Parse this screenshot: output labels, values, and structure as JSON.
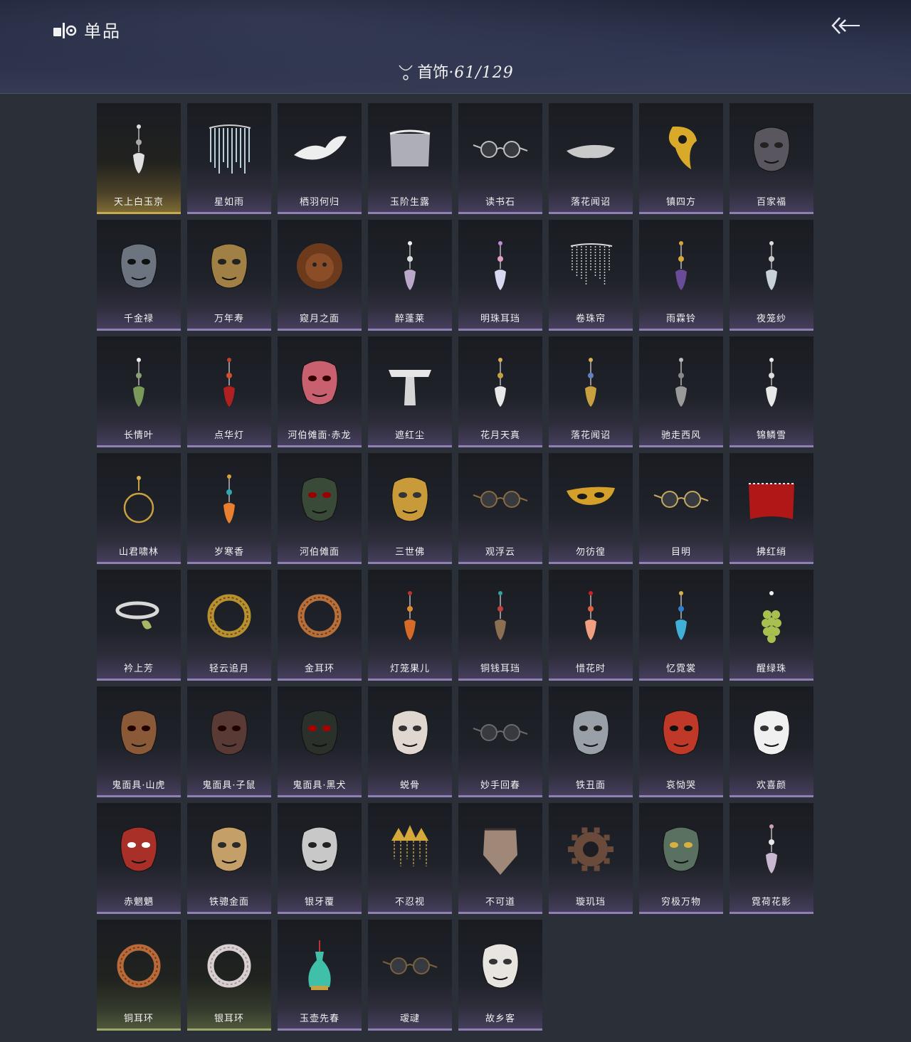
{
  "header": {
    "title": "单品",
    "category_label": "首饰",
    "category_count": "·61/129"
  },
  "items": [
    {
      "name": "天上白玉京",
      "rarity": "gold",
      "icon": "pendant-drop"
    },
    {
      "name": "星如雨",
      "rarity": "purple",
      "icon": "chain-curtain"
    },
    {
      "name": "栖羽何归",
      "rarity": "purple",
      "icon": "wing"
    },
    {
      "name": "玉阶生露",
      "rarity": "purple",
      "icon": "veil"
    },
    {
      "name": "读书石",
      "rarity": "purple",
      "icon": "glasses-round"
    },
    {
      "name": "落花闻诏",
      "rarity": "purple",
      "icon": "headband"
    },
    {
      "name": "镇四方",
      "rarity": "purple",
      "icon": "gold-filigree"
    },
    {
      "name": "百家福",
      "rarity": "purple",
      "icon": "mask-ram"
    },
    {
      "name": "千金禄",
      "rarity": "purple",
      "icon": "mask-mouse-silver"
    },
    {
      "name": "万年寿",
      "rarity": "purple",
      "icon": "mask-mouse-gold"
    },
    {
      "name": "窥月之面",
      "rarity": "purple",
      "icon": "mask-lion"
    },
    {
      "name": "醉蓬莱",
      "rarity": "purple",
      "icon": "flower-hairpin"
    },
    {
      "name": "明珠耳珰",
      "rarity": "purple",
      "icon": "pearl-earring"
    },
    {
      "name": "卷珠帘",
      "rarity": "purple",
      "icon": "bead-curtain"
    },
    {
      "name": "雨霖铃",
      "rarity": "purple",
      "icon": "bell-earring"
    },
    {
      "name": "夜笼纱",
      "rarity": "purple",
      "icon": "silver-tassel"
    },
    {
      "name": "长情叶",
      "rarity": "purple",
      "icon": "leaf-earring"
    },
    {
      "name": "点华灯",
      "rarity": "purple",
      "icon": "lantern"
    },
    {
      "name": "河伯傩面·赤龙",
      "rarity": "purple",
      "icon": "mask-red-dragon"
    },
    {
      "name": "遮红尘",
      "rarity": "purple",
      "icon": "white-ribbon"
    },
    {
      "name": "花月天真",
      "rarity": "purple",
      "icon": "gold-stick-earring"
    },
    {
      "name": "落花闻诏",
      "rarity": "purple",
      "icon": "gold-stick-earring-2"
    },
    {
      "name": "驰走西风",
      "rarity": "purple",
      "icon": "feather-earring"
    },
    {
      "name": "锦鳞雪",
      "rarity": "purple",
      "icon": "fish-earring"
    },
    {
      "name": "山君啸林",
      "rarity": "purple",
      "icon": "hoop-earring"
    },
    {
      "name": "岁寒香",
      "rarity": "purple",
      "icon": "gem-earring"
    },
    {
      "name": "河伯傩面",
      "rarity": "purple",
      "icon": "mask-green-dragon"
    },
    {
      "name": "三世佛",
      "rarity": "purple",
      "icon": "mask-three-faces"
    },
    {
      "name": "观浮云",
      "rarity": "purple",
      "icon": "goggles"
    },
    {
      "name": "勿彷徨",
      "rarity": "purple",
      "icon": "gold-eyemask"
    },
    {
      "name": "目明",
      "rarity": "purple",
      "icon": "glasses-thin"
    },
    {
      "name": "拂红绡",
      "rarity": "purple",
      "icon": "red-veil"
    },
    {
      "name": "衿上芳",
      "rarity": "purple",
      "icon": "silver-ring-leaf"
    },
    {
      "name": "轻云追月",
      "rarity": "purple",
      "icon": "gold-torque"
    },
    {
      "name": "金耳环",
      "rarity": "purple",
      "icon": "copper-ring"
    },
    {
      "name": "灯笼果儿",
      "rarity": "purple",
      "icon": "berry-earring"
    },
    {
      "name": "铜钱耳珰",
      "rarity": "purple",
      "icon": "coin-earring"
    },
    {
      "name": "惜花时",
      "rarity": "purple",
      "icon": "petal-earring"
    },
    {
      "name": "忆霓裳",
      "rarity": "purple",
      "icon": "blue-gem-earring"
    },
    {
      "name": "醒绿珠",
      "rarity": "purple",
      "icon": "grapes-earring"
    },
    {
      "name": "鬼面具·山虎",
      "rarity": "purple",
      "icon": "mask-tiger"
    },
    {
      "name": "鬼面具·子鼠",
      "rarity": "purple",
      "icon": "mask-rat"
    },
    {
      "name": "鬼面具·黑犬",
      "rarity": "purple",
      "icon": "mask-black-dog"
    },
    {
      "name": "蜕骨",
      "rarity": "purple",
      "icon": "mask-jester"
    },
    {
      "name": "妙手回春",
      "rarity": "purple",
      "icon": "monocle"
    },
    {
      "name": "铁丑面",
      "rarity": "purple",
      "icon": "mask-iron"
    },
    {
      "name": "哀恸哭",
      "rarity": "purple",
      "icon": "mask-red-oni"
    },
    {
      "name": "欢喜颜",
      "rarity": "purple",
      "icon": "mask-white-smile"
    },
    {
      "name": "赤魍魉",
      "rarity": "purple",
      "icon": "mask-red-demon"
    },
    {
      "name": "铁骢金面",
      "rarity": "purple",
      "icon": "mask-leather"
    },
    {
      "name": "银牙覆",
      "rarity": "purple",
      "icon": "mask-silver-teeth"
    },
    {
      "name": "不忍视",
      "rarity": "purple",
      "icon": "gold-crown"
    },
    {
      "name": "不可道",
      "rarity": "purple",
      "icon": "face-scarf"
    },
    {
      "name": "璇玑珰",
      "rarity": "purple",
      "icon": "gear-ring"
    },
    {
      "name": "穷极万物",
      "rarity": "purple",
      "icon": "bronze-mask"
    },
    {
      "name": "霓荷花影",
      "rarity": "purple",
      "icon": "lotus-earring"
    },
    {
      "name": "铜耳环",
      "rarity": "green",
      "icon": "copper-ring-2"
    },
    {
      "name": "银耳环",
      "rarity": "green",
      "icon": "silver-ring"
    },
    {
      "name": "玉壶先春",
      "rarity": "purple",
      "icon": "jade-vase"
    },
    {
      "name": "叆叇",
      "rarity": "purple",
      "icon": "monocle-2"
    },
    {
      "name": "故乡客",
      "rarity": "purple",
      "icon": "mask-half-white"
    }
  ],
  "colors": {
    "rarity_gold": "#c9a94e",
    "rarity_purple": "#8f7fb5",
    "rarity_green": "#9aa86c"
  }
}
